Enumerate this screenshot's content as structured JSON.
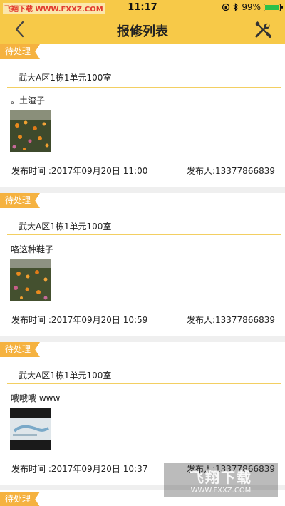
{
  "status_bar": {
    "watermark": "飞翔下载 WWW.FXXZ.COM",
    "time": "11:17",
    "battery": "99%",
    "battery_level": 0.99
  },
  "navbar": {
    "title": "报修列表",
    "back_icon": "chevron-left-icon",
    "tools_icon": "wrench-screwdriver-icon"
  },
  "colors": {
    "accent": "#f7c948",
    "badge": "#f5b240",
    "divider": "#f3cf62",
    "background": "#efefef"
  },
  "repairs": [
    {
      "status": "待处理",
      "address": "武大A区1栋1单元100室",
      "description": "。土渣子",
      "time": "发布时间 :2017年09月20日 11:00",
      "publisher": "发布人:13377866839",
      "image": "flowers-photo"
    },
    {
      "status": "待处理",
      "address": "武大A区1栋1单元100室",
      "description": "咯这种鞋子",
      "time": "发布时间 :2017年09月20日 10:59",
      "publisher": "发布人:13377866839",
      "image": "flowers-photo"
    },
    {
      "status": "待处理",
      "address": "武大A区1栋1单元100室",
      "description": "哦哦哦 www",
      "time": "发布时间 :2017年09月20日 10:37",
      "publisher": "发布人:13377866839",
      "image": "screenshot-photo"
    },
    {
      "status": "待处理"
    }
  ],
  "logo_watermark": {
    "big": "飞翔下载",
    "small": "WWW.FXXZ.COM"
  }
}
